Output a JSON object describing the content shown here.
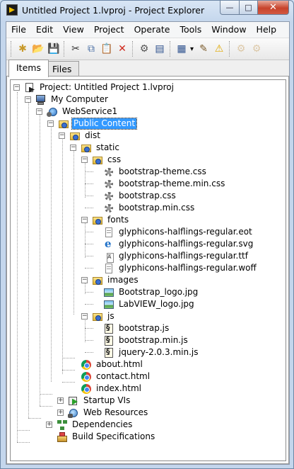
{
  "window": {
    "title": "Untitled Project 1.lvproj - Project Explorer",
    "controls": {
      "minimize": "—",
      "maximize": "□",
      "close": "✕"
    }
  },
  "menubar": {
    "items": [
      "File",
      "Edit",
      "View",
      "Project",
      "Operate",
      "Tools",
      "Window",
      "Help"
    ]
  },
  "toolbar": {
    "buttons": [
      {
        "name": "new-icon",
        "glyph": "✱"
      },
      {
        "name": "open-folder-icon",
        "glyph": "📂"
      },
      {
        "name": "save-all-icon",
        "glyph": "💾"
      },
      {
        "name": "cut-icon",
        "glyph": "✂"
      },
      {
        "name": "copy-icon",
        "glyph": "⧉"
      },
      {
        "name": "paste-icon",
        "glyph": "📋"
      },
      {
        "name": "delete-icon",
        "glyph": "✕"
      },
      {
        "name": "build-icon",
        "glyph": "⚙"
      },
      {
        "name": "deploy-icon",
        "glyph": "▤"
      },
      {
        "name": "view-options-icon",
        "glyph": "▦"
      },
      {
        "name": "dropdown-arrow-icon",
        "glyph": "▾"
      },
      {
        "name": "project-items-icon",
        "glyph": "✎"
      },
      {
        "name": "warning-icon",
        "glyph": "⚠"
      },
      {
        "name": "disabled-tool-1-icon",
        "glyph": "⚙"
      },
      {
        "name": "disabled-tool-2-icon",
        "glyph": "⚙"
      }
    ]
  },
  "tabs": [
    {
      "label": "Items",
      "active": true
    },
    {
      "label": "Files",
      "active": false
    }
  ],
  "tree": {
    "selected": "Public Content",
    "items": [
      {
        "label": "Project: Untitled Project 1.lvproj",
        "icon": "project-icon"
      },
      {
        "label": "My Computer",
        "icon": "computer-icon"
      },
      {
        "label": "WebService1",
        "icon": "webservice-icon"
      },
      {
        "label": "Public Content",
        "icon": "virtual-folder-icon"
      },
      {
        "label": "dist",
        "icon": "virtual-folder-icon"
      },
      {
        "label": "static",
        "icon": "virtual-folder-icon"
      },
      {
        "label": "css",
        "icon": "virtual-folder-icon"
      },
      {
        "label": "bootstrap-theme.css",
        "icon": "css-file-icon"
      },
      {
        "label": "bootstrap-theme.min.css",
        "icon": "css-file-icon"
      },
      {
        "label": "bootstrap.css",
        "icon": "css-file-icon"
      },
      {
        "label": "bootstrap.min.css",
        "icon": "css-file-icon"
      },
      {
        "label": "fonts",
        "icon": "virtual-folder-icon"
      },
      {
        "label": "glyphicons-halflings-regular.eot",
        "icon": "file-icon"
      },
      {
        "label": "glyphicons-halflings-regular.svg",
        "icon": "ie-file-icon"
      },
      {
        "label": "glyphicons-halflings-regular.ttf",
        "icon": "font-file-icon"
      },
      {
        "label": "glyphicons-halflings-regular.woff",
        "icon": "file-icon"
      },
      {
        "label": "images",
        "icon": "virtual-folder-icon"
      },
      {
        "label": "Bootstrap_logo.jpg",
        "icon": "image-file-icon"
      },
      {
        "label": "LabVIEW_logo.jpg",
        "icon": "image-file-icon"
      },
      {
        "label": "js",
        "icon": "virtual-folder-icon"
      },
      {
        "label": "bootstrap.js",
        "icon": "script-file-icon"
      },
      {
        "label": "bootstrap.min.js",
        "icon": "script-file-icon"
      },
      {
        "label": "jquery-2.0.3.min.js",
        "icon": "script-file-icon"
      },
      {
        "label": "about.html",
        "icon": "chrome-file-icon"
      },
      {
        "label": "contact.html",
        "icon": "chrome-file-icon"
      },
      {
        "label": "index.html",
        "icon": "chrome-file-icon"
      },
      {
        "label": "Startup VIs",
        "icon": "startup-vis-icon"
      },
      {
        "label": "Web Resources",
        "icon": "web-resources-icon"
      },
      {
        "label": "Dependencies",
        "icon": "dependencies-icon"
      },
      {
        "label": "Build Specifications",
        "icon": "build-specs-icon"
      }
    ]
  },
  "colors": {
    "selection": "#3399ff",
    "title_bar": "#c4d6ec",
    "close_button": "#c7432b"
  }
}
